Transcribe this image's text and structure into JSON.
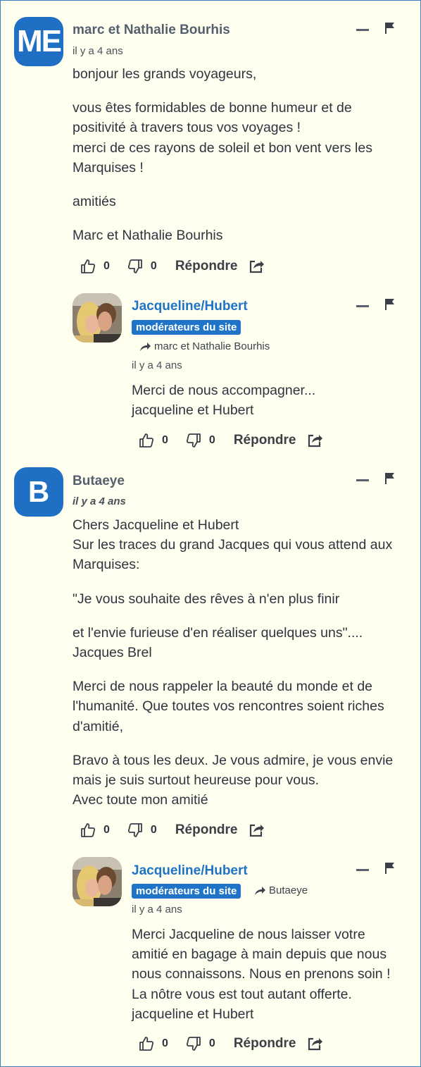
{
  "comments": [
    {
      "author": "marc et Nathalie Bourhis",
      "avatar_initials": "ME",
      "time": "il y a 4 ans",
      "paragraphs": [
        [
          "bonjour les grands voyageurs,"
        ],
        [
          "vous êtes formidables de bonne humeur et de",
          "positivité à travers tous vos voyages !",
          "merci de ces rayons de soleil et bon vent vers les",
          "Marquises !"
        ],
        [
          "amitiés"
        ],
        [
          "Marc et Nathalie Bourhis"
        ]
      ],
      "likes": "0",
      "dislikes": "0",
      "reply_label": "Répondre"
    },
    {
      "author": "Jacqueline/Hubert",
      "badge": "modérateurs du site",
      "reply_to": "marc et Nathalie Bourhis",
      "time": "il y a 4 ans",
      "paragraphs": [
        [
          "Merci de nous accompagner...",
          "jacqueline et Hubert"
        ]
      ],
      "likes": "0",
      "dislikes": "0",
      "reply_label": "Répondre"
    },
    {
      "author": "Butaeye",
      "avatar_initials": "B",
      "time": "il y a 4 ans",
      "paragraphs": [
        [
          "Chers Jacqueline et Hubert",
          "Sur les traces du grand Jacques qui vous attend aux",
          "Marquises:"
        ],
        [
          "\"Je vous souhaite des rêves à n'en plus finir"
        ],
        [
          "et l'envie furieuse d'en réaliser quelques uns\"....",
          "Jacques Brel"
        ],
        [
          "Merci de nous rappeler la beauté du monde et de",
          "l'humanité. Que toutes vos rencontres soient riches",
          "d'amitié,"
        ],
        [
          "Bravo à tous les deux. Je vous admire, je vous envie",
          "mais je suis surtout heureuse pour vous.",
          "Avec toute mon amitié"
        ]
      ],
      "likes": "0",
      "dislikes": "0",
      "reply_label": "Répondre"
    },
    {
      "author": "Jacqueline/Hubert",
      "badge": "modérateurs du site",
      "reply_to": "Butaeye",
      "time": "il y a 4 ans",
      "paragraphs": [
        [
          "Merci Jacqueline de nous laisser votre",
          "amitié en bagage à main depuis que nous",
          "nous connaissons. Nous en prenons soin !",
          "La nôtre vous est tout autant offerte.",
          "jacqueline et Hubert"
        ]
      ],
      "likes": "0",
      "dislikes": "0",
      "reply_label": "Répondre"
    }
  ],
  "colors": {
    "background": "#fffff0",
    "avatar_blue": "#1f6fc5",
    "moderator_blue": "#1f74c7",
    "text": "#2e3440"
  },
  "icons": [
    "collapse-icon",
    "flag-icon",
    "thumbs-up-icon",
    "thumbs-down-icon",
    "share-icon",
    "reply-arrow-icon",
    "user-photo-avatar"
  ]
}
